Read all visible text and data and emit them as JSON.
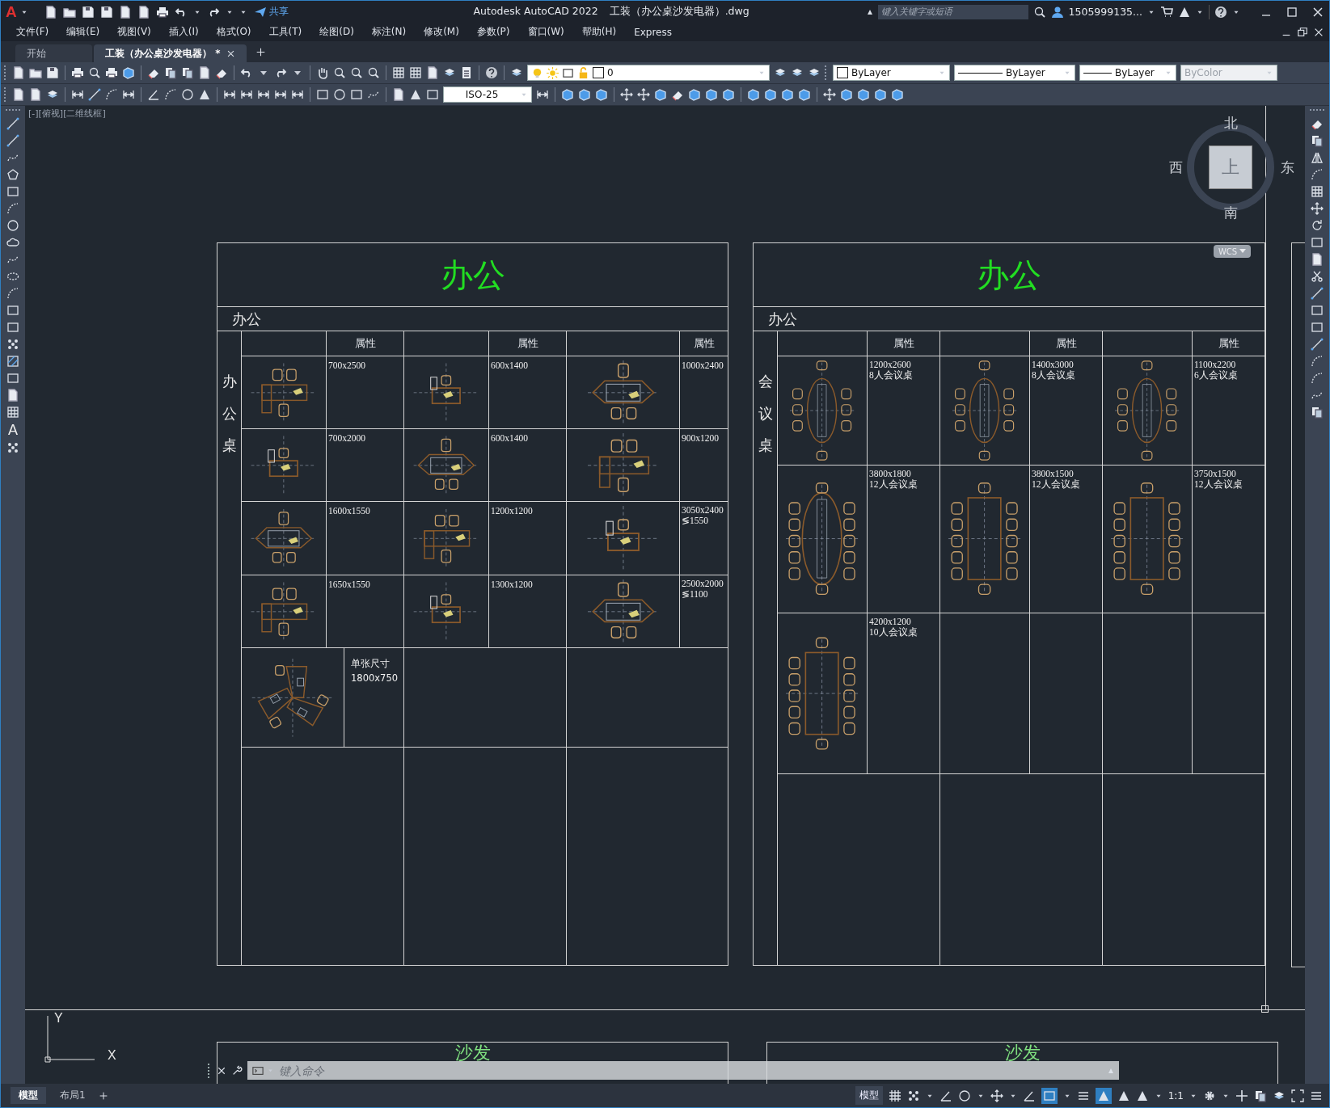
{
  "title_bar": {
    "logo": "A",
    "share": "共享",
    "app": "Autodesk AutoCAD 2022",
    "file": "工装（办公桌沙发电器）.dwg",
    "search": {
      "placeholder": "键入关键字或短语"
    },
    "user": "1505999135..."
  },
  "menu": [
    "文件(F)",
    "编辑(E)",
    "视图(V)",
    "插入(I)",
    "格式(O)",
    "工具(T)",
    "绘图(D)",
    "标注(N)",
    "修改(M)",
    "参数(P)",
    "窗口(W)",
    "帮助(H)",
    "Express"
  ],
  "doc_tabs": [
    {
      "label": "开始",
      "selected": false,
      "closable": false
    },
    {
      "label": "工装（办公桌沙发电器） *",
      "selected": true,
      "closable": true
    }
  ],
  "properties": {
    "layer": "0",
    "object_color": "ByLayer",
    "linetype": "ByLayer",
    "lineweight": "ByLayer",
    "plot_style": {
      "value": "ByColor",
      "disabled": true
    }
  },
  "dim_style": "ISO-25",
  "text_tool": "A",
  "viewport_label": "[-][俯视][二维线框]",
  "viewcube": {
    "north": "北",
    "south": "南",
    "east": "东",
    "west": "西",
    "top": "上",
    "ucs": "WCS"
  },
  "sheets": [
    {
      "title": "办公",
      "subtitle": "办公",
      "category": "办公桌",
      "headers": [
        "属性",
        "属性",
        "属性"
      ],
      "rows": [
        {
          "kind": "triple",
          "cells": [
            {
              "kind": "desk",
              "lines": [
                "700x2500"
              ]
            },
            {
              "kind": "desk",
              "lines": [
                "600x1400"
              ]
            },
            {
              "kind": "desk",
              "lines": [
                "1000x2400"
              ]
            }
          ]
        },
        {
          "kind": "triple",
          "cells": [
            {
              "kind": "desk",
              "lines": [
                "700x2000"
              ]
            },
            {
              "kind": "desk",
              "lines": [
                "600x1400"
              ]
            },
            {
              "kind": "desk",
              "lines": [
                "900x1200"
              ]
            }
          ]
        },
        {
          "kind": "triple",
          "cells": [
            {
              "kind": "desk",
              "lines": [
                "1600x1550"
              ]
            },
            {
              "kind": "desk",
              "lines": [
                "1200x1200"
              ]
            },
            {
              "kind": "desk",
              "lines": [
                "3050x2400",
                "≶1550"
              ]
            }
          ]
        },
        {
          "kind": "triple",
          "cells": [
            {
              "kind": "desk",
              "lines": [
                "1650x1550"
              ]
            },
            {
              "kind": "desk",
              "lines": [
                "1300x1200"
              ]
            },
            {
              "kind": "desk",
              "lines": [
                "2500x2000",
                "≶1100"
              ]
            }
          ]
        },
        {
          "kind": "single",
          "cells": [
            {
              "kind": "cluster",
              "lines": [
                "单张尺寸",
                "1800x750"
              ]
            }
          ]
        },
        {
          "kind": "blank",
          "cells": []
        }
      ]
    },
    {
      "title": "办公",
      "subtitle": "办公",
      "category": "会议桌",
      "headers": [
        "属性",
        "属性",
        "属性"
      ],
      "rows": [
        {
          "kind": "triple",
          "cells": [
            {
              "kind": "oval-table",
              "lines": [
                "1200x2600",
                "8人会议桌"
              ]
            },
            {
              "kind": "oval-table",
              "lines": [
                "1400x3000",
                "8人会议桌"
              ]
            },
            {
              "kind": "oval-table",
              "lines": [
                "1100x2200",
                "6人会议桌"
              ]
            }
          ]
        },
        {
          "kind": "triple",
          "cells": [
            {
              "kind": "oval-table",
              "lines": [
                "3800x1800",
                "12人会议桌"
              ]
            },
            {
              "kind": "rect-table",
              "lines": [
                "3800x1500",
                "12人会议桌"
              ]
            },
            {
              "kind": "rect-table",
              "lines": [
                "3750x1500",
                "12人会议桌"
              ]
            }
          ]
        },
        {
          "kind": "triple",
          "cells": [
            {
              "kind": "rect-table",
              "lines": [
                "4200x1200",
                "10人会议桌"
              ]
            }
          ]
        },
        {
          "kind": "blank",
          "cells": []
        }
      ]
    }
  ],
  "bottom_sheets": [
    {
      "title": "沙发"
    },
    {
      "title": "沙发"
    }
  ],
  "ucs_axes": {
    "x": "X",
    "y": "Y"
  },
  "command_line": {
    "placeholder": "键入命令"
  },
  "layout_tabs": [
    {
      "label": "模型",
      "selected": true
    },
    {
      "label": "布局1",
      "selected": false
    }
  ],
  "status_bar": {
    "space": "模型",
    "scale": "1:1"
  }
}
